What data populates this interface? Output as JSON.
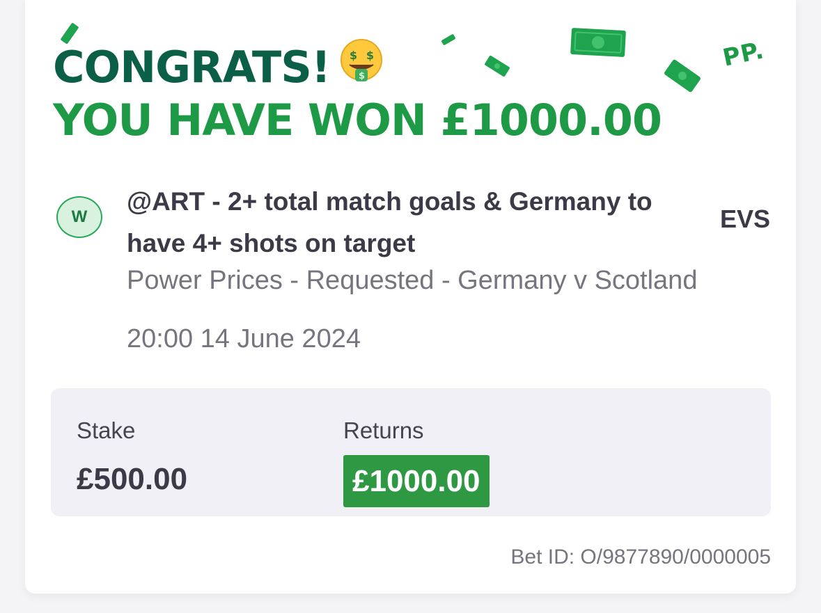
{
  "header": {
    "congrats": "CONGRATS!",
    "win_line": "YOU HAVE WON £1000.00",
    "emoji_icon": "money-mouth-face-icon",
    "brand_logo": "PP."
  },
  "bet": {
    "result_badge": "W",
    "selection": "@ART - 2+ total match goals & Germany to have 4+ shots on target",
    "odds": "EVS",
    "market": "Power Prices - Requested - Germany v Scotland",
    "event_time": "20:00 14 June 2024"
  },
  "summary": {
    "stake_label": "Stake",
    "stake_value": "£500.00",
    "returns_label": "Returns",
    "returns_value": "£1000.00"
  },
  "footer": {
    "bet_id": "Bet ID: O/9877890/0000005"
  },
  "colors": {
    "dark_green": "#0b5f47",
    "bright_green": "#1e9a46",
    "returns_badge": "#2f9843",
    "text_dark": "#3b3a46",
    "text_muted": "#76757f",
    "summary_bg": "#f0f0f6"
  }
}
